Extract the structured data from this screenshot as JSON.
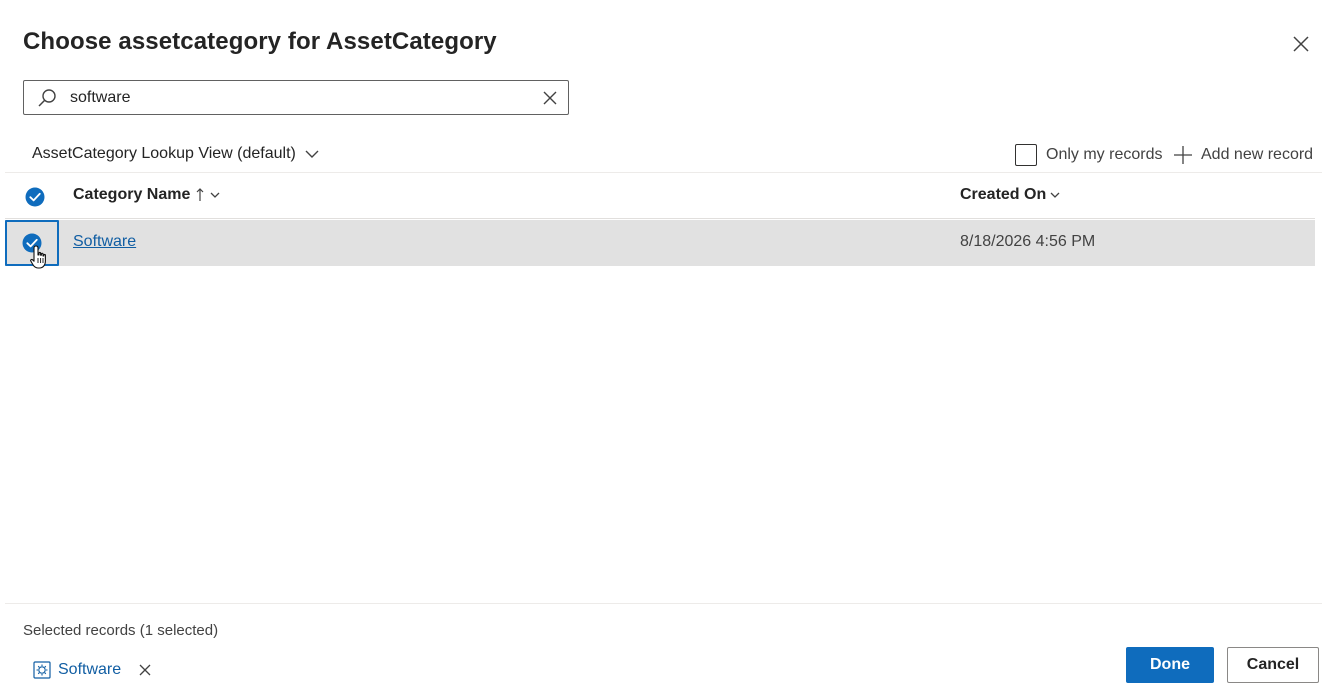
{
  "dialog": {
    "title": "Choose assetcategory for AssetCategory"
  },
  "search": {
    "value": "software"
  },
  "view": {
    "name": "AssetCategory Lookup View (default)"
  },
  "toolbar": {
    "only_my_records_label": "Only my records",
    "only_my_records_checked": false,
    "add_new_record_label": "Add new record"
  },
  "grid": {
    "columns": [
      {
        "label": "Category Name",
        "sort": "ascending"
      },
      {
        "label": "Created On",
        "sort": "none"
      }
    ],
    "rows": [
      {
        "name": "Software",
        "created_on": "8/18/2026 4:56 PM",
        "selected": true
      }
    ]
  },
  "selection": {
    "title": "Selected records (1 selected)",
    "items": [
      {
        "label": "Software"
      }
    ]
  },
  "footer": {
    "done_label": "Done",
    "cancel_label": "Cancel"
  },
  "colors": {
    "accent": "#0f6cbd",
    "link": "#115ea3",
    "selected_row": "#e1e1e1"
  },
  "icons": {
    "close": "close-icon",
    "search": "search-icon",
    "clear": "clear-icon",
    "dropdown": "chevron-down-icon",
    "add": "plus-icon",
    "check": "checkmark-circle-icon",
    "sort_up": "sort-ascending-icon",
    "record": "entity-record-icon",
    "cursor": "hand-cursor-icon"
  }
}
